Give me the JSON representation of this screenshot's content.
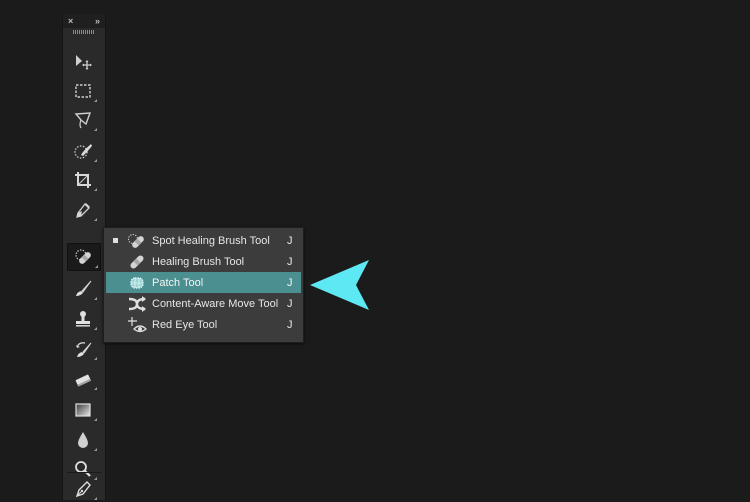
{
  "toolbar": {
    "close_glyph": "×",
    "collapse_glyph": "»",
    "tools": [
      {
        "name": "move-tool",
        "icon": "move-icon"
      },
      {
        "name": "rectangular-marquee-tool",
        "icon": "marquee-icon"
      },
      {
        "name": "lasso-tool",
        "icon": "lasso-icon"
      },
      {
        "name": "quick-selection-tool",
        "icon": "quick-selection-icon"
      },
      {
        "name": "crop-tool",
        "icon": "crop-icon"
      },
      {
        "name": "eyedropper-tool",
        "icon": "eyedropper-icon"
      },
      {
        "name": "spot-healing-brush-tool",
        "icon": "bandage-icon",
        "active": true
      },
      {
        "name": "brush-tool",
        "icon": "brush-icon"
      },
      {
        "name": "clone-stamp-tool",
        "icon": "stamp-icon"
      },
      {
        "name": "history-brush-tool",
        "icon": "history-brush-icon"
      },
      {
        "name": "eraser-tool",
        "icon": "eraser-icon"
      },
      {
        "name": "gradient-tool",
        "icon": "gradient-icon"
      },
      {
        "name": "blur-tool",
        "icon": "drop-icon"
      },
      {
        "name": "dodge-tool",
        "icon": "dodge-icon"
      },
      {
        "name": "pen-tool",
        "icon": "pen-icon"
      }
    ]
  },
  "flyout": {
    "items": [
      {
        "label": "Spot Healing Brush Tool",
        "shortcut": "J",
        "current": true,
        "selected": false,
        "icon": "spot-healing-icon"
      },
      {
        "label": "Healing Brush Tool",
        "shortcut": "J",
        "current": false,
        "selected": false,
        "icon": "healing-brush-icon"
      },
      {
        "label": "Patch Tool",
        "shortcut": "J",
        "current": false,
        "selected": true,
        "icon": "patch-icon"
      },
      {
        "label": "Content-Aware Move Tool",
        "shortcut": "J",
        "current": false,
        "selected": false,
        "icon": "content-aware-move-icon"
      },
      {
        "label": "Red Eye Tool",
        "shortcut": "J",
        "current": false,
        "selected": false,
        "icon": "red-eye-icon"
      }
    ],
    "highlight_color": "#4b8f91"
  },
  "annotation": {
    "arrow_color": "#5ee8f4",
    "points_to": "Patch Tool"
  }
}
